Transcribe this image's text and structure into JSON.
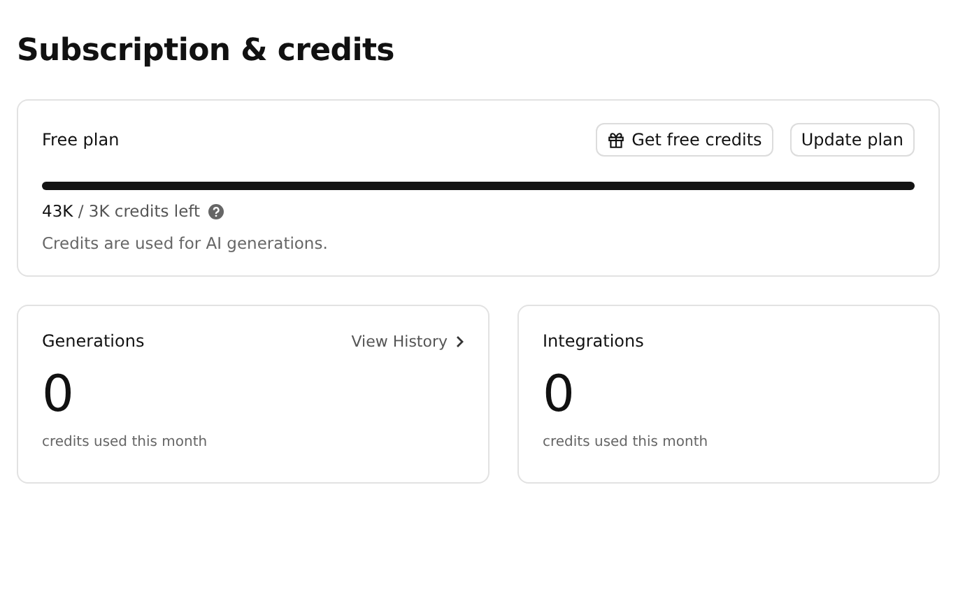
{
  "page": {
    "title": "Subscription & credits"
  },
  "plan": {
    "name": "Free plan",
    "buttons": [
      {
        "label": "Get free credits",
        "kind": "gift"
      },
      {
        "label": "Update plan",
        "kind": "plain"
      }
    ],
    "level": 1,
    "credits": "**43K** / 3K credits left",
    "note": "Credits are used for AI generations."
  },
  "stats": [
    {
      "title": "Generations",
      "link": "View History",
      "value": "0",
      "caption": "credits used this month"
    },
    {
      "title": "Integrations",
      "value": "0",
      "caption": "credits used this month"
    }
  ]
}
